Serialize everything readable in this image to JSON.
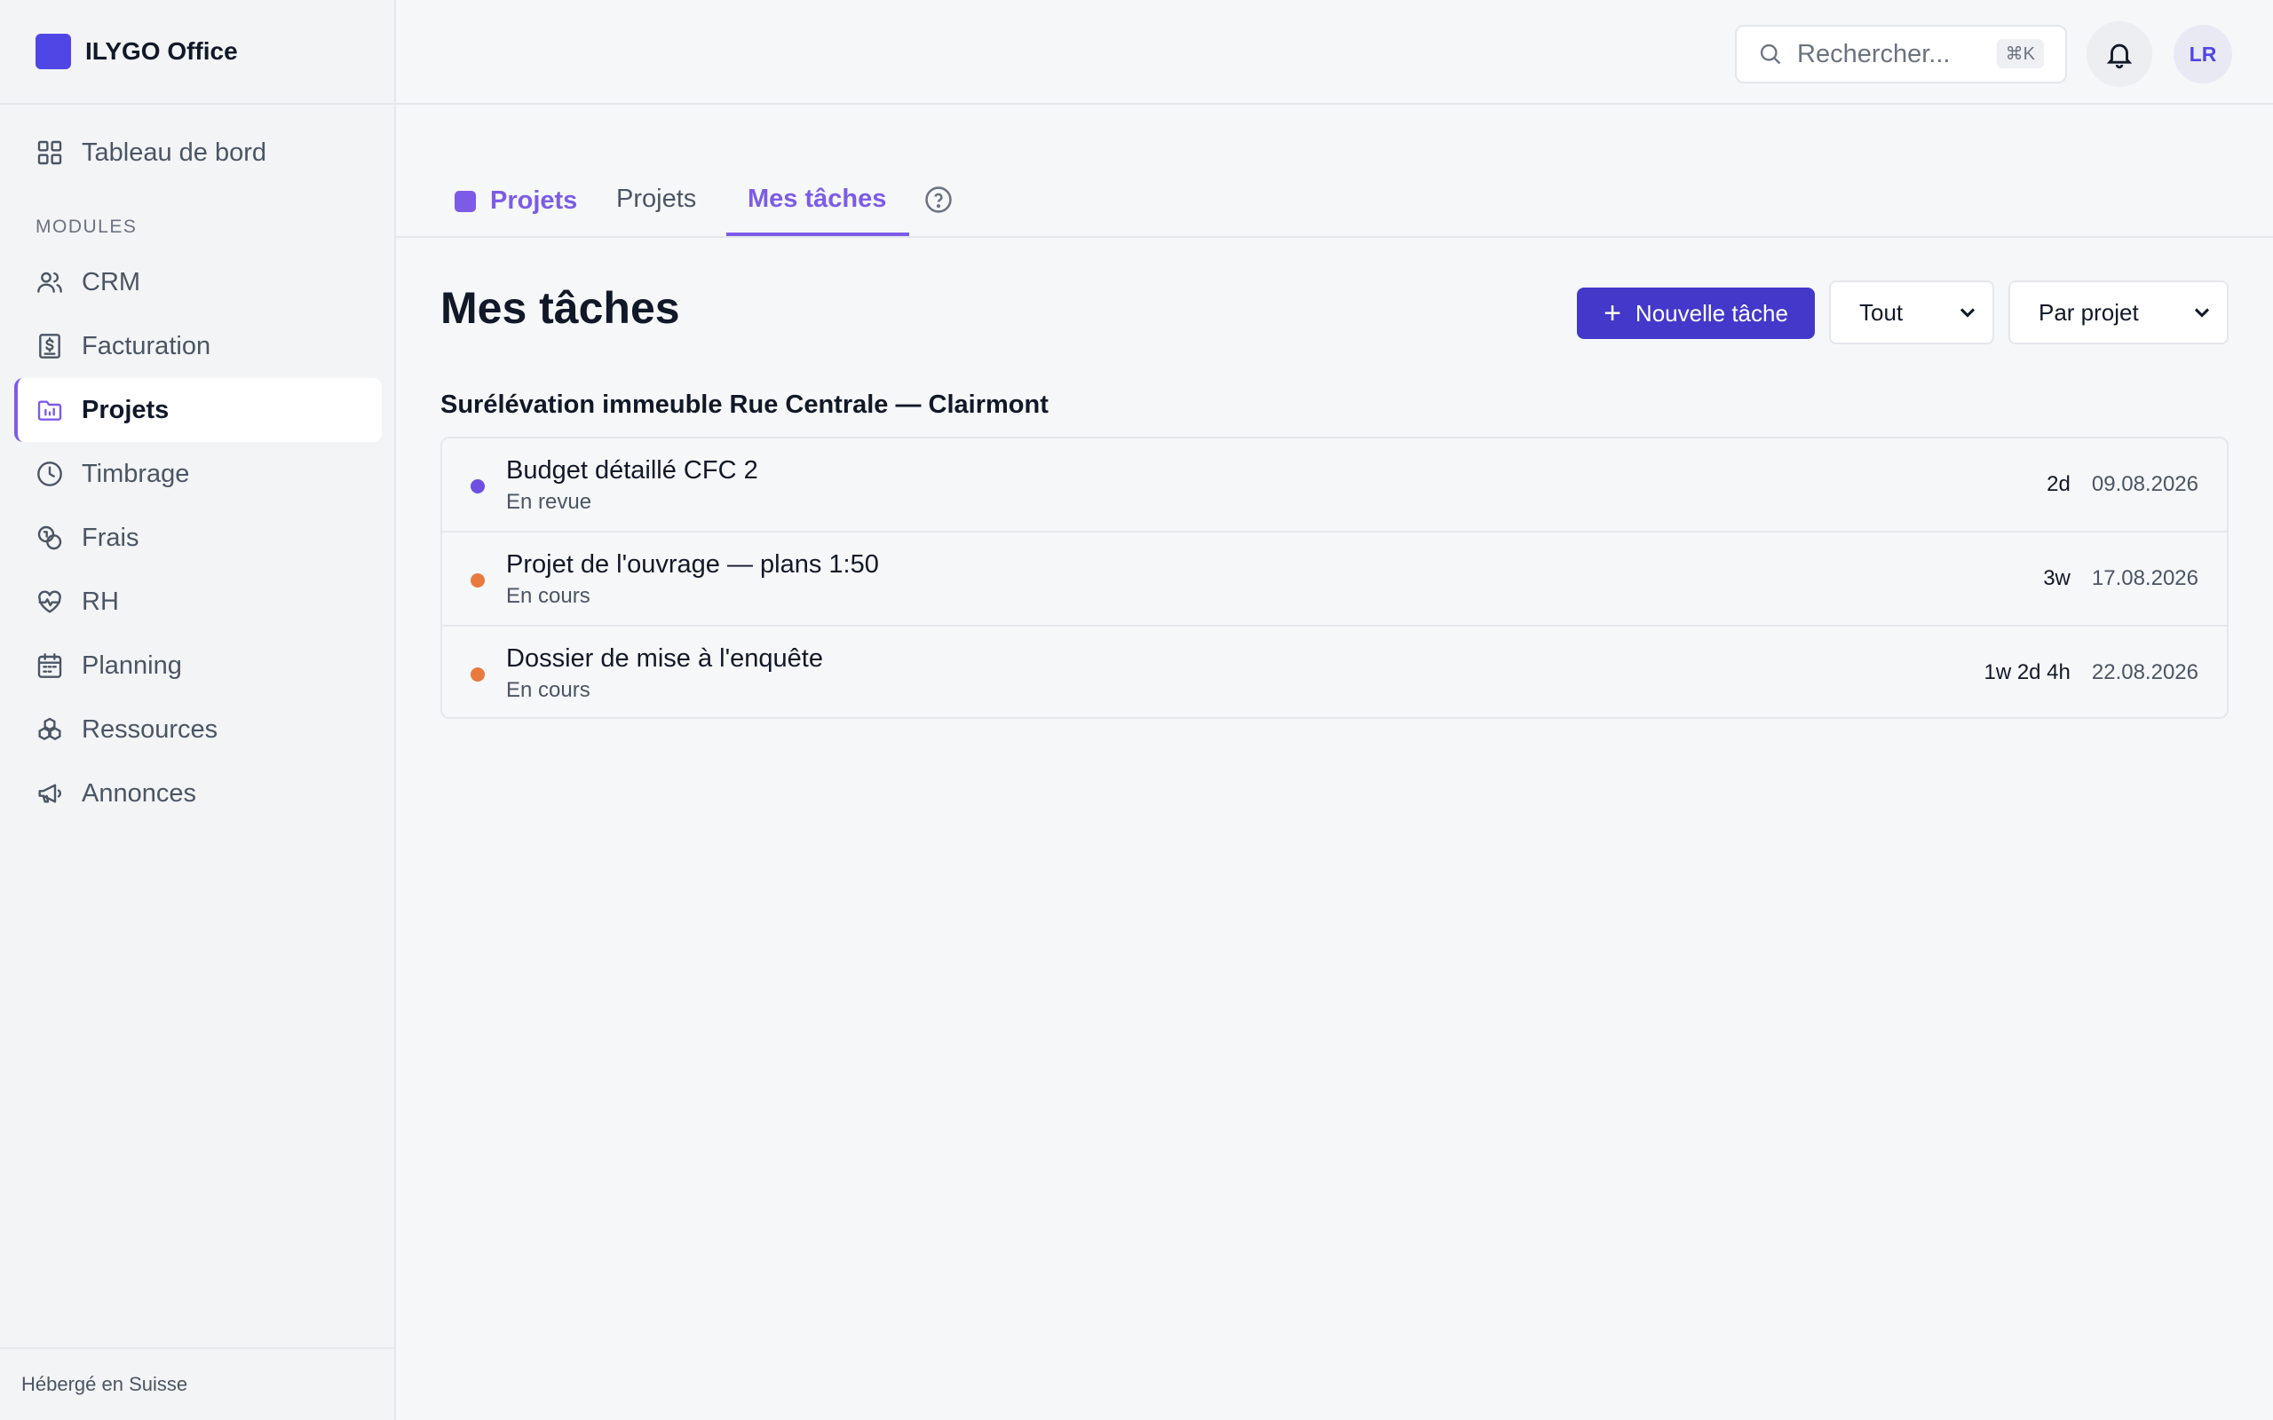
{
  "app": {
    "name": "ILYGO Office"
  },
  "sidebar": {
    "dashboard": "Tableau de bord",
    "section_label": "MODULES",
    "items": [
      {
        "label": "CRM",
        "icon": "users-icon"
      },
      {
        "label": "Facturation",
        "icon": "invoice-icon"
      },
      {
        "label": "Projets",
        "icon": "folder-icon"
      },
      {
        "label": "Timbrage",
        "icon": "clock-icon"
      },
      {
        "label": "Frais",
        "icon": "coins-icon"
      },
      {
        "label": "RH",
        "icon": "heart-pulse-icon"
      },
      {
        "label": "Planning",
        "icon": "calendar-icon"
      },
      {
        "label": "Ressources",
        "icon": "boxes-icon"
      },
      {
        "label": "Annonces",
        "icon": "megaphone-icon"
      }
    ],
    "footer": "Hébergé en Suisse"
  },
  "topbar": {
    "search_placeholder": "Rechercher...",
    "search_shortcut": "⌘K",
    "avatar_initials": "LR"
  },
  "tabs": {
    "module": "Projets",
    "projects": "Projets",
    "my_tasks": "Mes tâches"
  },
  "main": {
    "title": "Mes tâches",
    "new_task_button": "Nouvelle tâche",
    "filter_value": "Tout",
    "group_value": "Par projet",
    "groups": [
      {
        "title": "Surélévation immeuble Rue Centrale — Clairmont",
        "tasks": [
          {
            "name": "Budget détaillé CFC 2",
            "status": "En revue",
            "duration": "2d",
            "date": "09.08.2026",
            "status_color": "#6d4fe3"
          },
          {
            "name": "Projet de l'ouvrage — plans 1:50",
            "status": "En cours",
            "duration": "3w",
            "date": "17.08.2026",
            "status_color": "#e87a3e"
          },
          {
            "name": "Dossier de mise à l'enquête",
            "status": "En cours",
            "duration": "1w 2d 4h",
            "date": "22.08.2026",
            "status_color": "#e87a3e"
          }
        ]
      }
    ]
  },
  "colors": {
    "accent": "#7c5ce6",
    "primary_button": "#4338ca",
    "brand_logo": "#4f46e5"
  }
}
